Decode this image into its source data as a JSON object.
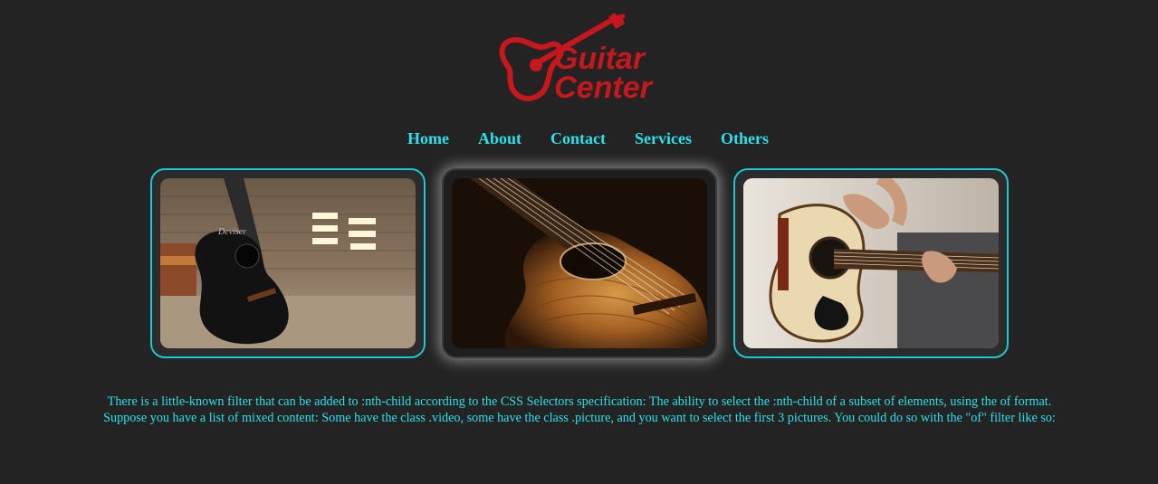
{
  "brand": {
    "logo_word_1": "Guitar",
    "logo_word_2": "Center",
    "logo_color": "#c8161d"
  },
  "nav": {
    "items": [
      {
        "label": "Home"
      },
      {
        "label": "About"
      },
      {
        "label": "Contact"
      },
      {
        "label": "Services"
      },
      {
        "label": "Others"
      }
    ],
    "color": "#2fe0ea"
  },
  "gallery": {
    "cards": [
      {
        "image": "black acoustic guitar in room",
        "style": "outlined"
      },
      {
        "image": "wooden acoustic guitar close-up",
        "style": "glow"
      },
      {
        "image": "person playing acoustic guitar",
        "style": "outlined"
      }
    ],
    "accent": "#19c9d4"
  },
  "content": {
    "paragraph": "There is a little-known filter that can be added to :nth-child according to the CSS Selectors specification: The ability to select the :nth-child of a subset of elements, using the of format. Suppose you have a list of mixed content: Some have the class .video, some have the class .picture, and you want to select the first 3 pictures. You could do so with the \"of\" filter like so:"
  }
}
